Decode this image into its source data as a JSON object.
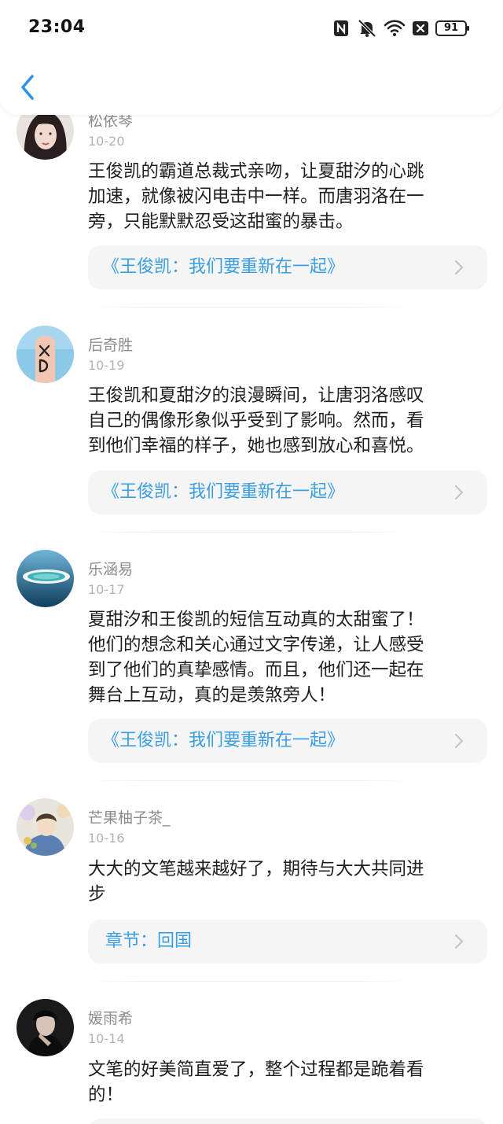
{
  "status_bar": {
    "time": "23:04",
    "icons": [
      "nfc-icon",
      "mute-icon",
      "wifi-icon",
      "close-box-icon"
    ],
    "battery": "91"
  },
  "header": {
    "back_icon": "chevron-left-icon"
  },
  "colors": {
    "link": "#3a9ee4",
    "card_bg": "#f5f5f5",
    "name": "#8d8d8d",
    "date": "#b3b3b3"
  },
  "comments": [
    {
      "user": "松依琴",
      "date": "10-20",
      "lines": [
        "王俊凯的霸道总裁式亲吻，让夏甜汐的心跳",
        "加速，就像被闪电击中一样。而唐羽洛在一",
        "旁，只能默默忍受这甜蜜的暴击。"
      ],
      "link": "《王俊凯：我们要重新在一起》"
    },
    {
      "user": "后奇胜",
      "date": "10-19",
      "lines": [
        "王俊凯和夏甜汐的浪漫瞬间，让唐羽洛感叹",
        "自己的偶像形象似乎受到了影响。然而，看",
        "到他们幸福的样子，她也感到放心和喜悦。"
      ],
      "link": "《王俊凯：我们要重新在一起》"
    },
    {
      "user": "乐涵易",
      "date": "10-17",
      "lines": [
        "夏甜汐和王俊凯的短信互动真的太甜蜜了！",
        "他们的想念和关心通过文字传递，让人感受",
        "到了他们的真挚感情。而且，他们还一起在",
        "舞台上互动，真的是羡煞旁人！"
      ],
      "link": "《王俊凯：我们要重新在一起》"
    },
    {
      "user": "芒果柚子茶_",
      "date": "10-16",
      "lines": [
        "大大的文笔越来越好了，期待与大大共同进",
        "步"
      ],
      "link": "章节：回国"
    },
    {
      "user": "媛雨希",
      "date": "10-14",
      "lines": [
        "文笔的好美简直爱了，整个过程都是跪着看",
        "的！"
      ],
      "link": ""
    }
  ]
}
